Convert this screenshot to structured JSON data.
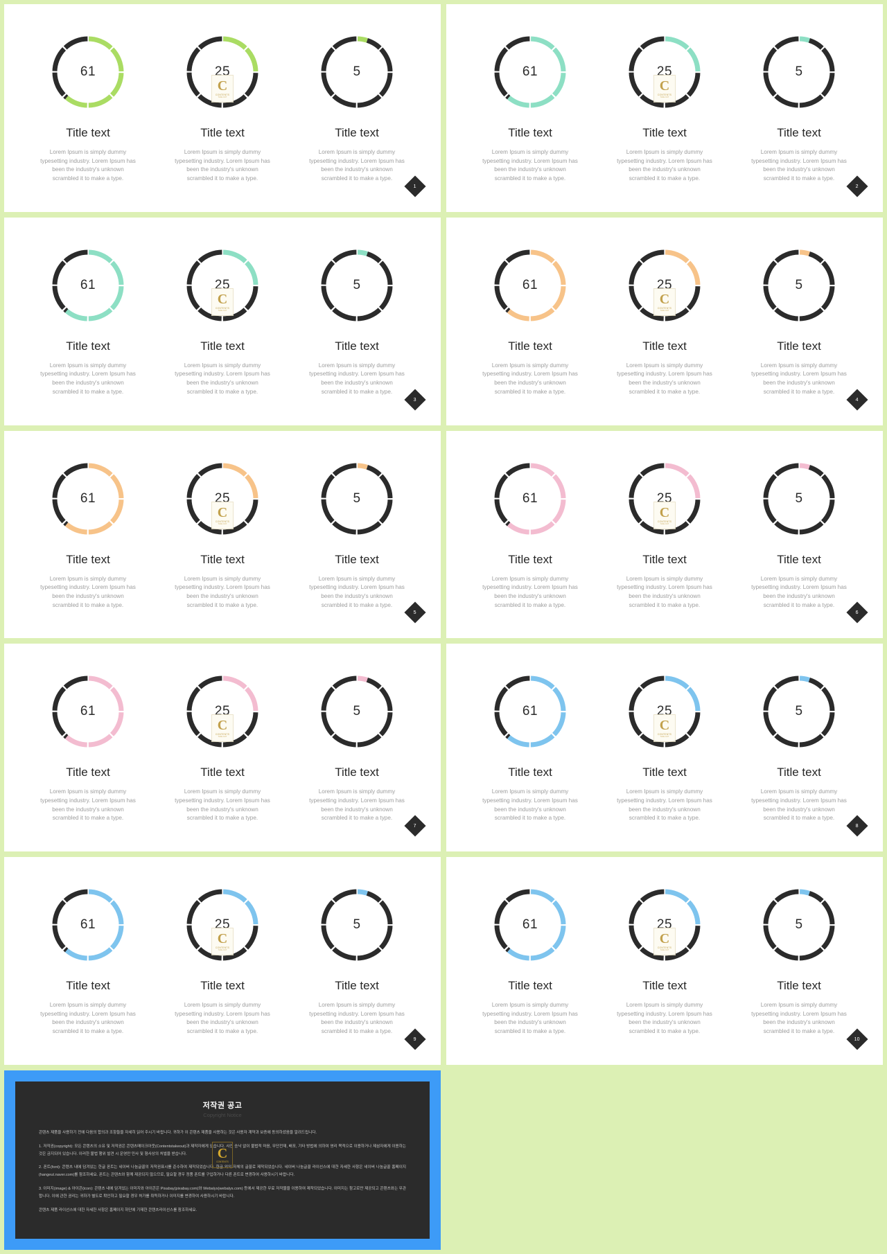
{
  "theme": {
    "page_background": "#dcf0b4",
    "slide_background": "#ffffff",
    "track_color": "#2b2b2b",
    "text_title_color": "#262626",
    "text_body_color": "#9d9d9d"
  },
  "chart_data": {
    "type": "pie",
    "title": "",
    "note": "Each slide shows three segmented donut gauges; the highlighted (accent) arc encodes the labelled percentage, the remainder is rendered in dark grey. Ring is split into 8 equal sectors separated by small white gaps.",
    "segments": 8,
    "gauges": [
      {
        "label": "Title text",
        "value": 61,
        "max": 100
      },
      {
        "label": "Title text",
        "value": 25,
        "max": 100
      },
      {
        "label": "Title text",
        "value": 5,
        "max": 100
      }
    ]
  },
  "common": {
    "title_text": "Title text",
    "body_text": "Lorem Ipsum is simply dummy typesetting industry. Lorem Ipsum has been the industry's unknown scrambled it to make a type.",
    "watermark": {
      "letter": "C",
      "label": "CONTENTS",
      "sub": "TAKE OUT"
    }
  },
  "slides": [
    {
      "id": "slide-1",
      "page": "1",
      "accent": "#aadc63",
      "values": [
        "61",
        "25",
        "5"
      ],
      "watermark_on": 1
    },
    {
      "id": "slide-2",
      "page": "2",
      "accent": "#8ddfc4",
      "values": [
        "61",
        "25",
        "5"
      ],
      "watermark_on": 1
    },
    {
      "id": "slide-3",
      "page": "3",
      "accent": "#8ddfc4",
      "values": [
        "61",
        "25",
        "5"
      ],
      "watermark_on": 1
    },
    {
      "id": "slide-4",
      "page": "4",
      "accent": "#f7c389",
      "values": [
        "61",
        "25",
        "5"
      ],
      "watermark_on": 1
    },
    {
      "id": "slide-5",
      "page": "5",
      "accent": "#f7c389",
      "values": [
        "61",
        "25",
        "5"
      ],
      "watermark_on": 1
    },
    {
      "id": "slide-6",
      "page": "6",
      "accent": "#f3bcd0",
      "values": [
        "61",
        "25",
        "5"
      ],
      "watermark_on": 1
    },
    {
      "id": "slide-7",
      "page": "7",
      "accent": "#f3bcd0",
      "values": [
        "61",
        "25",
        "5"
      ],
      "watermark_on": 1
    },
    {
      "id": "slide-8",
      "page": "8",
      "accent": "#7ec4ee",
      "values": [
        "61",
        "25",
        "5"
      ],
      "watermark_on": 1
    },
    {
      "id": "slide-9",
      "page": "9",
      "accent": "#7ec4ee",
      "values": [
        "61",
        "25",
        "5"
      ],
      "watermark_on": 1
    },
    {
      "id": "slide-10",
      "page": "10",
      "accent": "#7ec4ee",
      "values": [
        "61",
        "25",
        "5"
      ],
      "watermark_on": 1
    }
  ],
  "copyright": {
    "border_color": "#3d9bf7",
    "panel_color": "#2b2b2b",
    "title": "저작권 공고",
    "subtitle": "Copyright Notice",
    "paragraphs": [
      "콘텐츠 제품을 사용하기 전에 다음의 합의과 조항들을 자세히 읽어 주시기 바랍니다. 귀하가 이 콘텐츠 제품을 사용하는 것은 사용자 계약과 보증에 동의하셨음을 알려드립니다.",
      "1. 저작권(copyright): 모든 콘텐츠의 소유 및 저작권은 콘텐츠메이크아웃(Contentstakeout)과 제작자에게 있습니다. 사진 승낙 없이 불법적 마음, 무단전재, 배포, 기타 방법에 의하여 영리 목적으로 이용하거나 제삼자에게 이용하는 것은 금지되어 있습니다. 이러한 불법 행위 발견 시 운영만 민사 및 형사상의 처벌을 받습니다.",
      "2. 폰트(font): 콘텐츠 내에 담겨있는 한글 폰트는 네이버 나눔글꼴의 저작권표시를 준수하여 제작되었습니다. 한글 외의 자체의 글꼴로 제작되었습니다. 네이버 나눔글꼴 라이선스에 대한 자세한 사항은 네이버 나눔글꼴 홈페이지(hangeut.naver.com)를 참조하세요. 폰트는 콘텐츠와 함께 제공되지 않으므로, 필요할 경우 정품 폰트를 구입하거나 다른 폰트로 변경하여 사용하시기 바랍니다.",
      "3. 이미지(image) & 아이콘(icon): 콘텐츠 내에 담겨있는 이미지와 아이콘은 Pixabay(pixabay.com)와 Webalys(webalys.com) 등에서 제공한 무료 저작물을 이용하여 제작되었습니다. 이미지는 참고로만 제공되고 콘텐츠와는 무관합니다. 이에 관한 권리는 귀하가 별도로 확인하고 필요할 경우 허가를 취득하거나 이미지를 변경하여 사용하시기 바랍니다.",
      "콘텐츠 제품 라이선스에 대한 자세한 사항은 홈페이지 하단에 기재한 콘텐츠라이선스를 참조하세요."
    ],
    "watermark": {
      "letter": "C",
      "label": "CONTENTS"
    }
  }
}
